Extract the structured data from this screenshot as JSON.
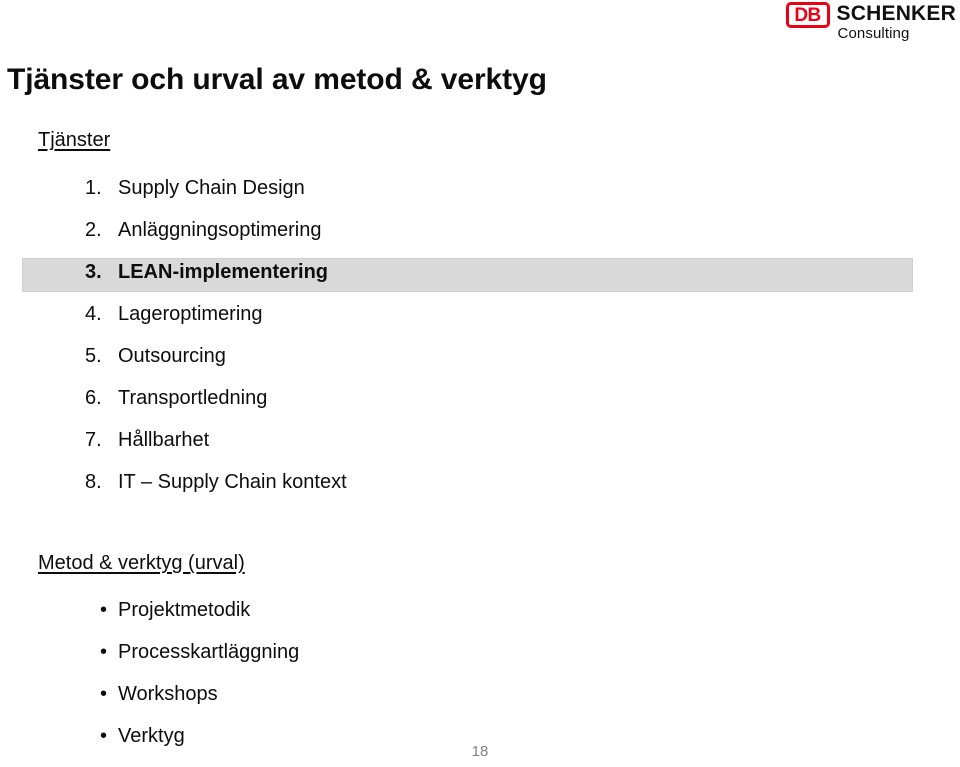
{
  "logo": {
    "mark_text": "DB",
    "brand": "SCHENKER",
    "subbrand": "Consulting",
    "red": "#ec0016"
  },
  "slide": {
    "title": "Tjänster och urval av metod & verktyg",
    "page_number": "18",
    "highlight_color": "#d9d9d9"
  },
  "services": {
    "heading": "Tjänster",
    "items": [
      {
        "marker": "1.",
        "label": "Supply Chain Design",
        "emphasis": false
      },
      {
        "marker": "2.",
        "label": "Anläggningsoptimering",
        "emphasis": false
      },
      {
        "marker": "3.",
        "label": "LEAN-implementering",
        "emphasis": true
      },
      {
        "marker": "4.",
        "label": "Lageroptimering",
        "emphasis": false
      },
      {
        "marker": "5.",
        "label": "Outsourcing",
        "emphasis": false
      },
      {
        "marker": "6.",
        "label": "Transportledning",
        "emphasis": false
      },
      {
        "marker": "7.",
        "label": "Hållbarhet",
        "emphasis": false
      },
      {
        "marker": "8.",
        "label": "IT – Supply Chain kontext",
        "emphasis": false
      }
    ]
  },
  "methods": {
    "heading": "Metod & verktyg (urval)",
    "items": [
      {
        "marker": "•",
        "label": "Projektmetodik"
      },
      {
        "marker": "•",
        "label": "Processkartläggning"
      },
      {
        "marker": "•",
        "label": "Workshops"
      },
      {
        "marker": "•",
        "label": "Verktyg"
      }
    ]
  }
}
